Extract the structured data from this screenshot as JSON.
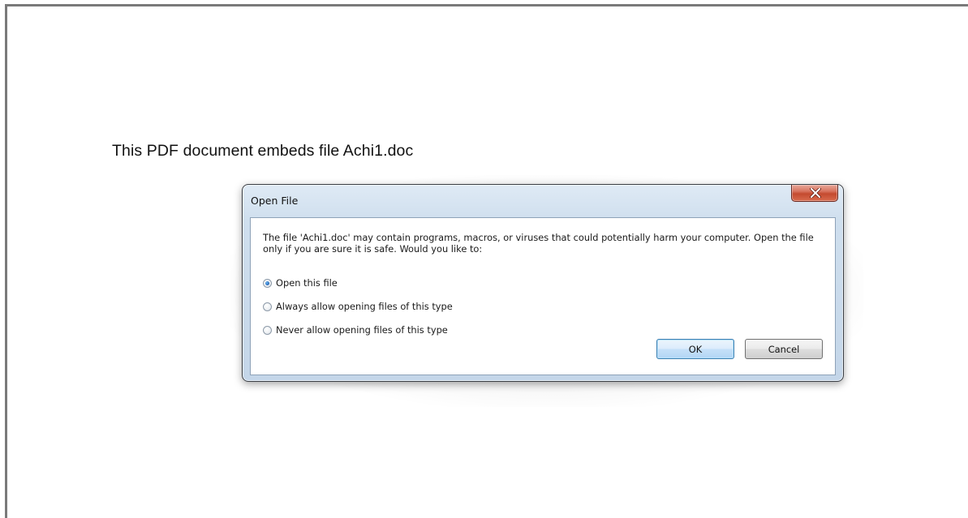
{
  "document": {
    "text": "This PDF document embeds file Achi1.doc"
  },
  "dialog": {
    "title": "Open File",
    "message": "The file 'Achi1.doc' may contain programs, macros, or viruses that could potentially harm your computer. Open the file only if you are sure it is safe. Would you like to:",
    "options": [
      {
        "label": "Open this file",
        "selected": true
      },
      {
        "label": "Always allow opening files of this type",
        "selected": false
      },
      {
        "label": "Never allow opening files of this type",
        "selected": false
      }
    ],
    "ok_label": "OK",
    "cancel_label": "Cancel",
    "close_icon": "close-icon"
  },
  "colors": {
    "close_button": "#c44a2f",
    "dialog_frame": "#c4d6e9",
    "default_button_border": "#3c7fb1",
    "radio_selected": "#2a6fc0"
  }
}
